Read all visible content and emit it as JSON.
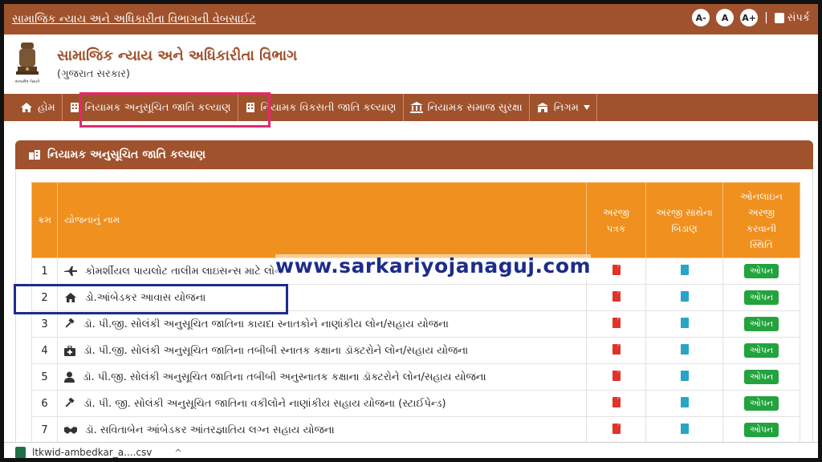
{
  "topbar": {
    "site_link": "સામાજિક ન્યાય અને અધિકારીતા વિભાગની વેબસાઈટ",
    "font_small": "A-",
    "font_normal": "A",
    "font_large": "A+",
    "separator": "|",
    "contact": "સંપર્ક"
  },
  "header": {
    "title": "સામાજિક ન્યાય અને અધિકારીતા વિભાગ",
    "subtitle": "(ગુજરાત સરકાર)",
    "emblem_caption": "સત્યમેવ જયતે"
  },
  "nav": {
    "items": [
      {
        "label": "હોમ",
        "icon": "home-icon"
      },
      {
        "label": "નિયામક અનુસૂચિત જાતિ કલ્યાણ",
        "icon": "building-icon"
      },
      {
        "label": "નિયામક વિકસતી જાતિ કલ્યાણ",
        "icon": "building-icon"
      },
      {
        "label": "નિયામક સમાજ સુરક્ષા",
        "icon": "bank-icon"
      },
      {
        "label": "નિગમ",
        "icon": "institution-icon"
      }
    ]
  },
  "card": {
    "title": "નિયામક અનુસૂચિત જાતિ કલ્યાણ"
  },
  "table": {
    "headers": {
      "sr": "ક્રમ",
      "name": "યોજનાનું નામ",
      "form_line1": "અરજી",
      "form_line2": "પત્રક",
      "att_line1": "અરજી સાથેના",
      "att_line2": "બિડાણ",
      "status_line1": "ઓનલાઇન",
      "status_line2": "અરજી",
      "status_line3": "કરવાની",
      "status_line4": "સ્થિતિ"
    },
    "rows": [
      {
        "sr": "1",
        "name": "કોમર્શીયલ પાયલોટ તાલીમ લાઇસન્સ માટે લોન",
        "icon": "plane-icon",
        "status": "ઓપન"
      },
      {
        "sr": "2",
        "name": "ડો.આંબેડકર આવાસ યોજના",
        "icon": "home-icon",
        "status": "ઓપન"
      },
      {
        "sr": "3",
        "name": "ડૉ. પી.જી. સોલંકી અનુસૂચિત જાતિના કાયદા સ્નાતકોને નાણાંકીય લોન/સહાય યોજના",
        "icon": "gavel-icon",
        "status": "ઓપન"
      },
      {
        "sr": "4",
        "name": "ડૉ. પી.જી. સોલંકી અનુસૂચિત જાતિના તબીબી સ્નાતક કક્ષાના ડૉક્ટરોને લોન/સહાય યોજના",
        "icon": "medkit-icon",
        "status": "ઓપન"
      },
      {
        "sr": "5",
        "name": "ડૉ. પી.જી. સોલંકી અનુસૂચિત જાતિના તબીબી અનુસ્નાતક કક્ષાના ડૉક્ટરોને લોન/સહાય યોજના",
        "icon": "doctor-icon",
        "status": "ઓપન"
      },
      {
        "sr": "6",
        "name": "ડૉ. પી. જી. સોલંકી અનુસૂચિત જાતિના વકીલોને નાણાંકીય સહાય યોજના (સ્ટાઈપેન્ડ)",
        "icon": "gavel-icon",
        "status": "ઓપન"
      },
      {
        "sr": "7",
        "name": "ડૉ. સવિતાબેન આંબેડકર આંતરજ્ઞાતિય લગ્ન સહાય યોજના",
        "icon": "handshake-icon",
        "status": "ઓપન"
      }
    ]
  },
  "watermark": "www.sarkariyojanaguj.com",
  "download_bar": {
    "file_name": "ltkwid-ambedkar_a....csv",
    "chevron": "^"
  },
  "colors": {
    "brand_brown": "#a0522d",
    "table_header_orange": "#f0901e",
    "open_green": "#23a33d",
    "pdf_red": "#e0332a",
    "doc_blue": "#2aa3c9",
    "highlight_pink": "#e6286e",
    "highlight_navy": "#1d2c8a"
  }
}
